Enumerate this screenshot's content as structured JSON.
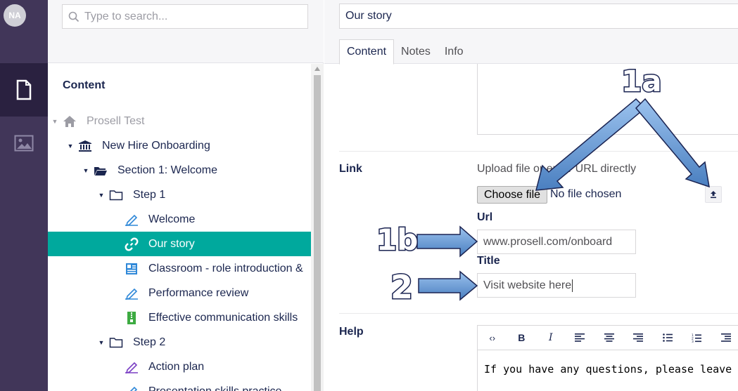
{
  "user": {
    "initials": "NA"
  },
  "rail": {
    "content_icon": "document-icon",
    "media_icon": "image-icon"
  },
  "search": {
    "placeholder": "Type to search..."
  },
  "tree": {
    "heading": "Content",
    "nodes": [
      {
        "label": "Prosell Test",
        "icon": "home-icon",
        "caret": true
      },
      {
        "label": "New Hire Onboarding",
        "icon": "bank-icon",
        "caret": true
      },
      {
        "label": "Section 1: Welcome",
        "icon": "folder-open-icon",
        "caret": true
      },
      {
        "label": "Step 1",
        "icon": "folder-icon",
        "caret": true
      },
      {
        "label": "Welcome",
        "icon": "edit-icon",
        "caret": false
      },
      {
        "label": "Our story",
        "icon": "link-icon",
        "caret": false
      },
      {
        "label": "Classroom - role introduction &",
        "icon": "newspaper-icon",
        "caret": false
      },
      {
        "label": "Performance review",
        "icon": "edit-icon",
        "caret": false
      },
      {
        "label": "Effective communication skills",
        "icon": "zip-icon",
        "caret": false
      },
      {
        "label": "Step 2",
        "icon": "folder-icon",
        "caret": true
      },
      {
        "label": "Action plan",
        "icon": "edit-icon",
        "caret": false
      },
      {
        "label": "Presentation skills practice",
        "icon": "edit-icon",
        "caret": false
      }
    ]
  },
  "editor": {
    "title": "Our story",
    "tabs": [
      "Content",
      "Notes",
      "Info"
    ],
    "link": {
      "label": "Link",
      "help": "Upload file or enter URL directly",
      "choose_file": "Choose file",
      "no_file": "No file chosen",
      "url_label": "Url",
      "url_value": "www.prosell.com/onboard",
      "title_label": "Title",
      "title_value": "Visit website here"
    },
    "help": {
      "label": "Help",
      "toolbar": [
        "code-icon",
        "bold-icon",
        "italic-icon",
        "align-left-icon",
        "align-center-icon",
        "align-right-icon",
        "bullet-list-icon",
        "numbered-list-icon",
        "indent-icon"
      ],
      "body": "If you have any questions, please leave us a comment"
    }
  },
  "annotations": {
    "a1": "1a",
    "a2": "1b",
    "a3": "2"
  },
  "colors": {
    "rail": "#413659",
    "selected": "#00a99d",
    "arrow": "#6c9bd2"
  }
}
